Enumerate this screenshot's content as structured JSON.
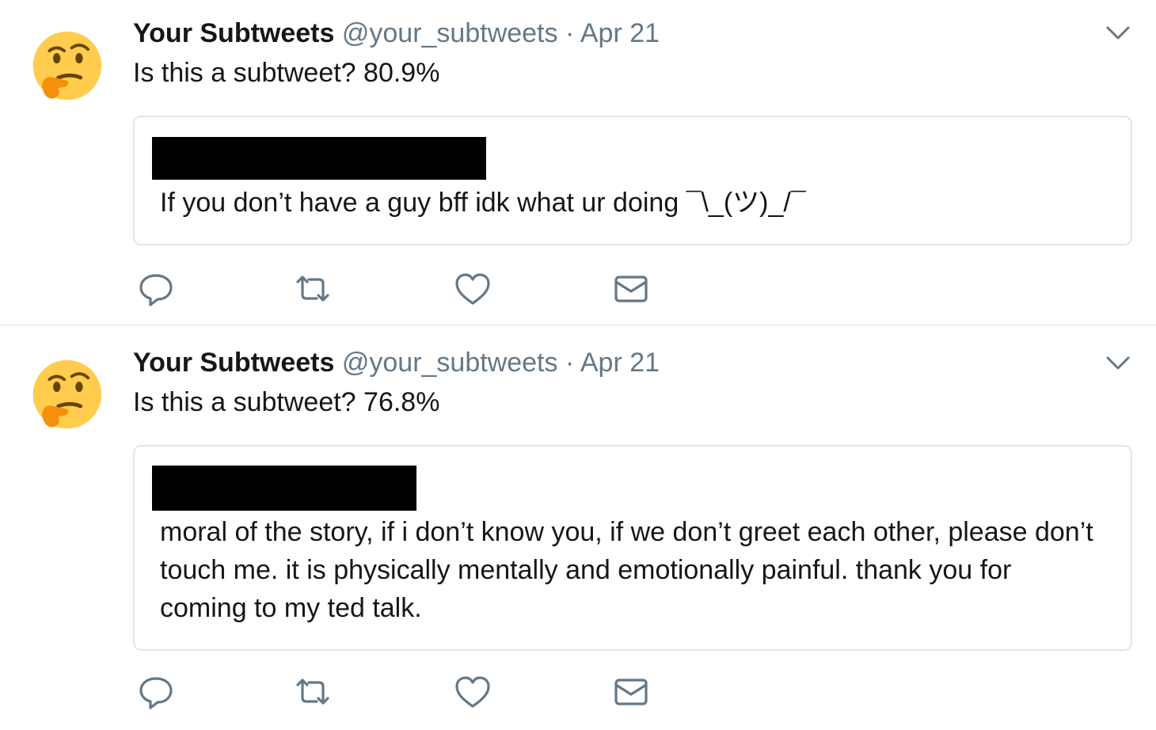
{
  "tweets": [
    {
      "author_name": "Your Subtweets",
      "author_handle": "@your_subtweets",
      "separator": "·",
      "date": "Apr 21",
      "text": "Is this a subtweet? 80.9%",
      "quoted_text": "If you don’t have a guy bff idk what ur doing ¯\\_(ツ)_/¯"
    },
    {
      "author_name": "Your Subtweets",
      "author_handle": "@your_subtweets",
      "separator": "·",
      "date": "Apr 21",
      "text": "Is this a subtweet? 76.8%",
      "quoted_text": "moral of the story, if i don’t know you, if we don’t greet each other, please don’t touch me. it is physically mentally and emotionally painful. thank you for coming to my ted talk."
    }
  ],
  "icons": {
    "avatar": "thinking-face-emoji",
    "menu": "chevron-down-icon",
    "reply": "reply-icon",
    "retweet": "retweet-icon",
    "like": "heart-icon",
    "dm": "envelope-icon"
  },
  "colors": {
    "name": "#14171a",
    "secondary": "#657786",
    "border": "#e1e8ed",
    "redaction": "#000000",
    "emoji_face": "#ffcc4d",
    "emoji_hand": "#f4900c"
  }
}
